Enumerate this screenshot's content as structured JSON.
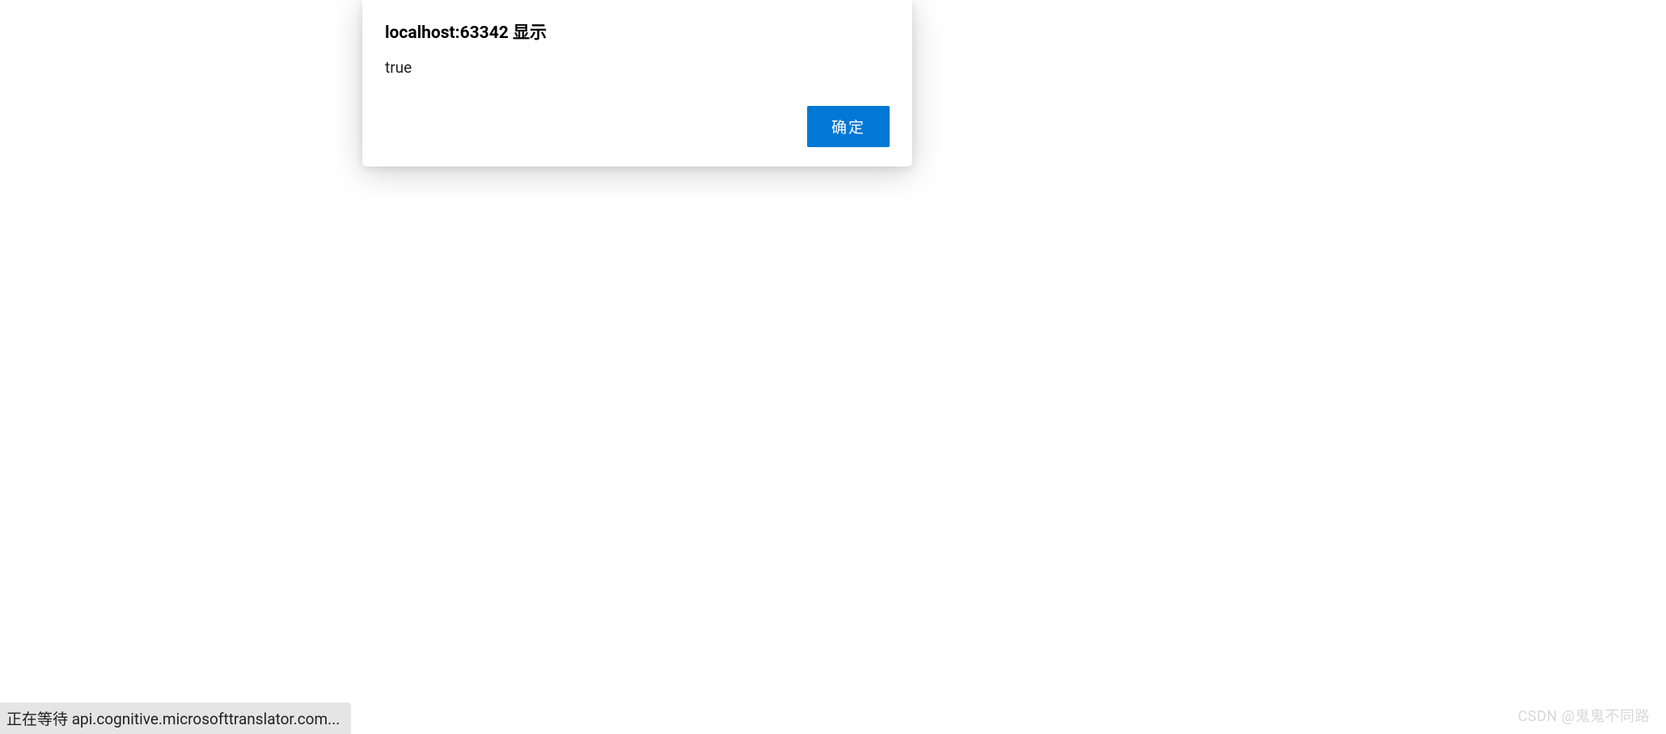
{
  "alert": {
    "title": "localhost:63342 显示",
    "message": "true",
    "confirm_label": "确定"
  },
  "status_bar": {
    "text": "正在等待 api.cognitive.microsofttranslator.com..."
  },
  "watermark": {
    "text": "CSDN @鬼鬼不同路"
  }
}
